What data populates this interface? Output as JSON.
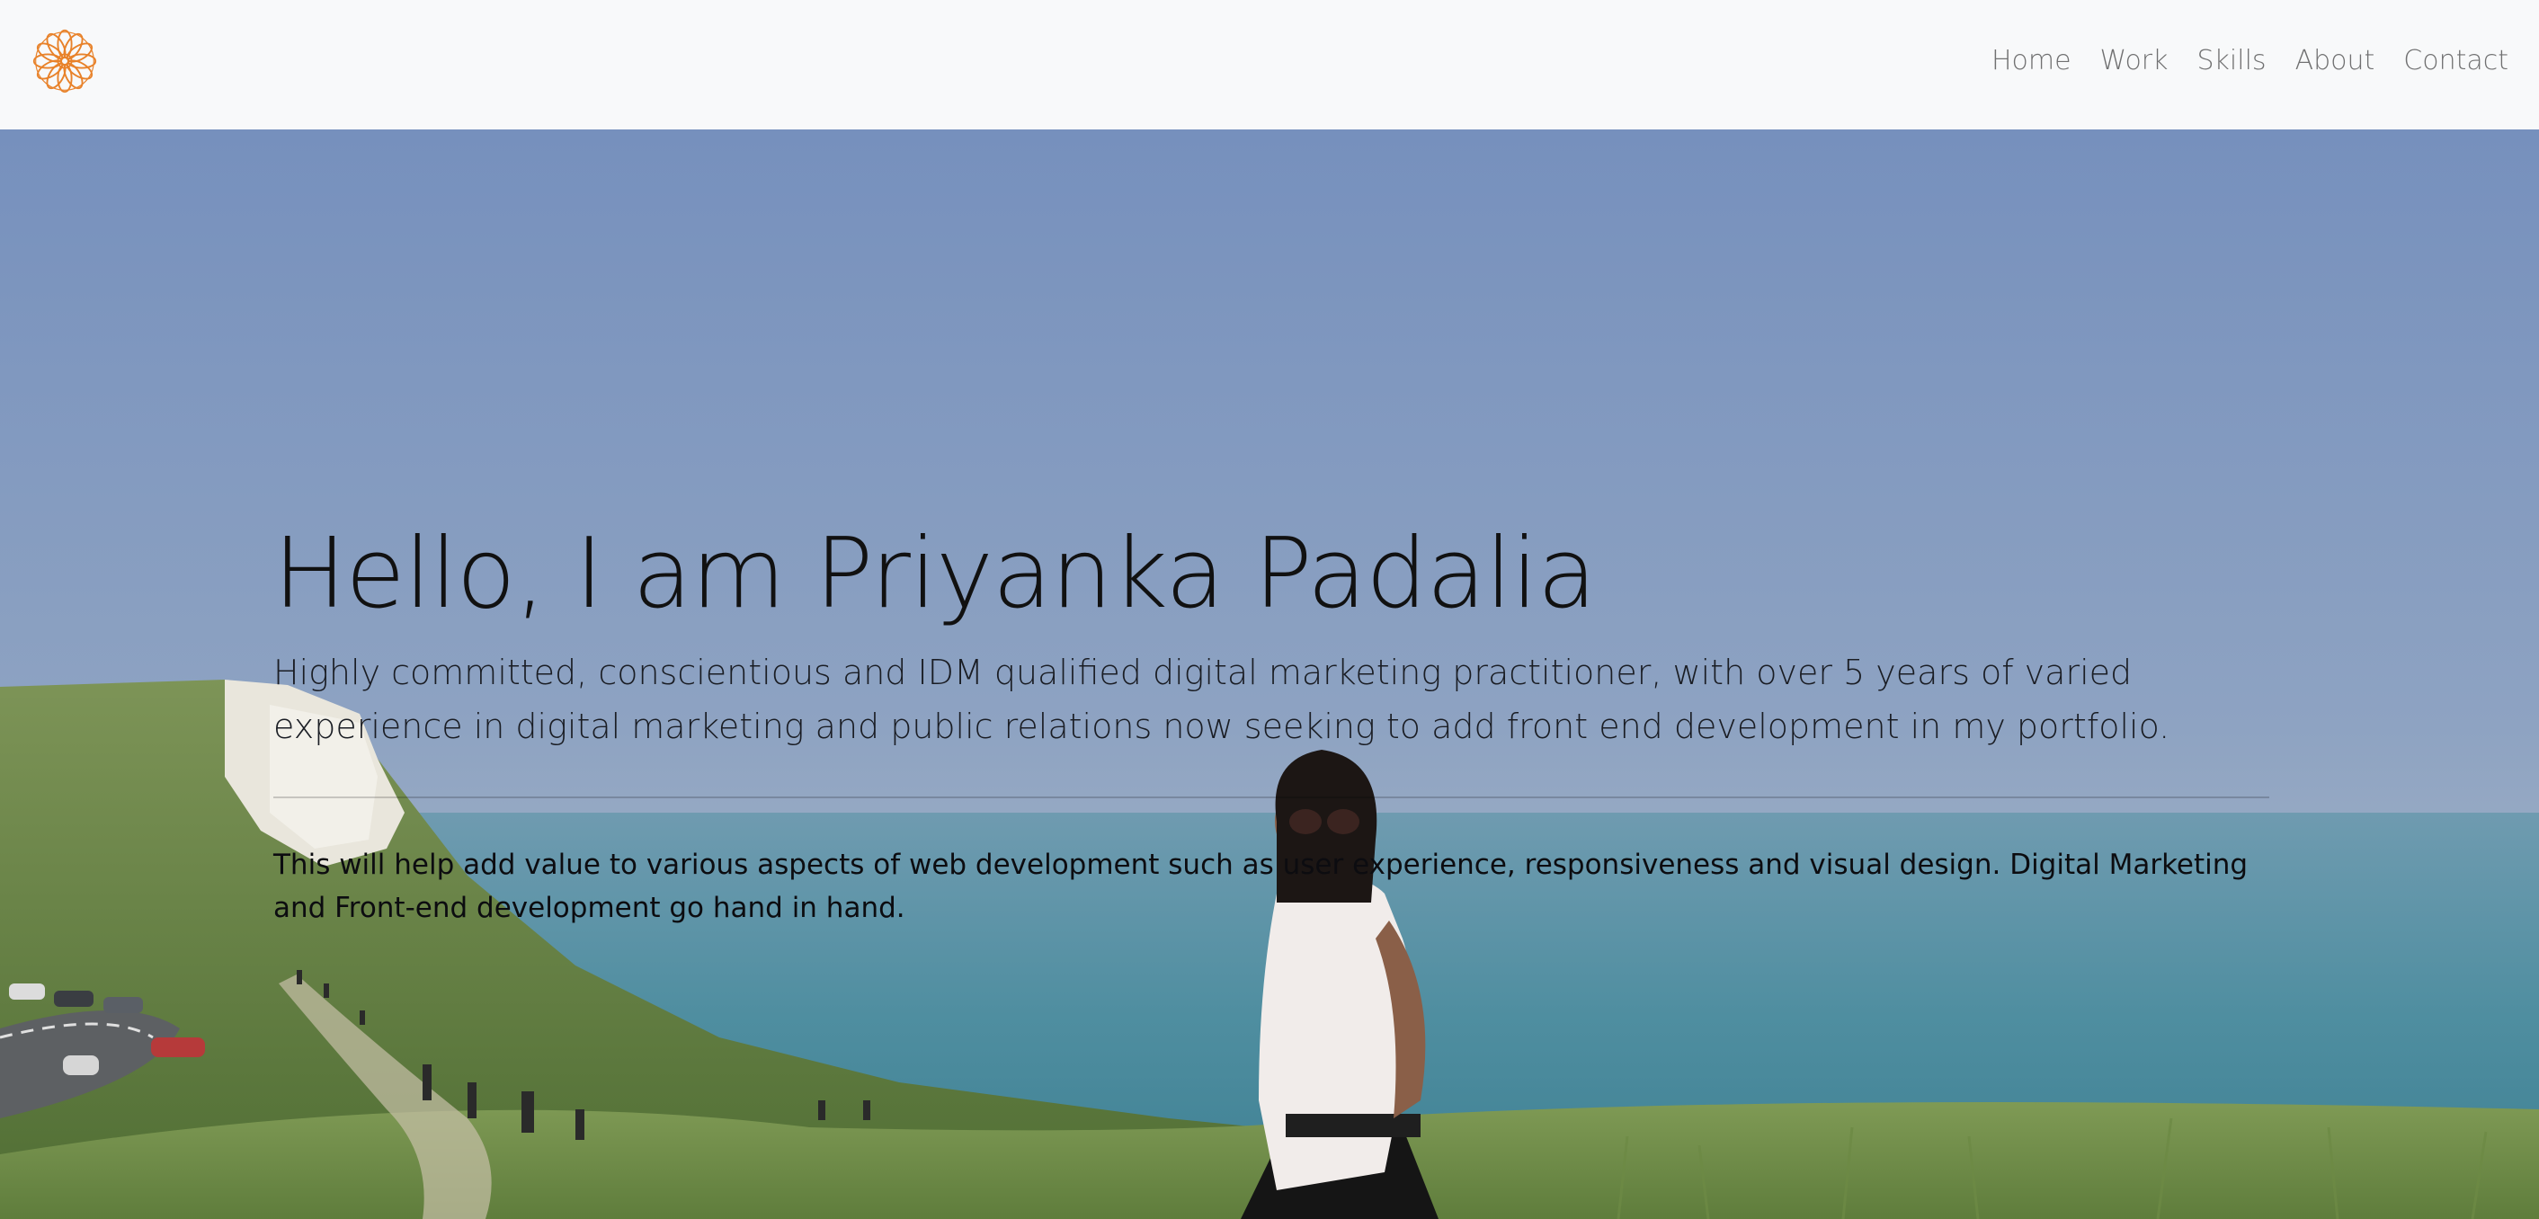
{
  "navbar": {
    "logo_icon": "mandala-flower-icon",
    "accent_color": "#e8822a",
    "links": [
      {
        "label": "Home"
      },
      {
        "label": "Work"
      },
      {
        "label": "Skills"
      },
      {
        "label": "About"
      },
      {
        "label": "Contact"
      }
    ]
  },
  "hero": {
    "title": "Hello, I am Priyanka Padalia",
    "lead": "Highly committed, conscientious and IDM qualified digital marketing practitioner, with over 5 years of varied experience in digital marketing and public relations now seeking to add front end development in my portfolio.",
    "body": "This will help add value to various aspects of web development such as user experience, responsiveness and visual design. Digital Marketing and Front-end development go hand in hand."
  }
}
